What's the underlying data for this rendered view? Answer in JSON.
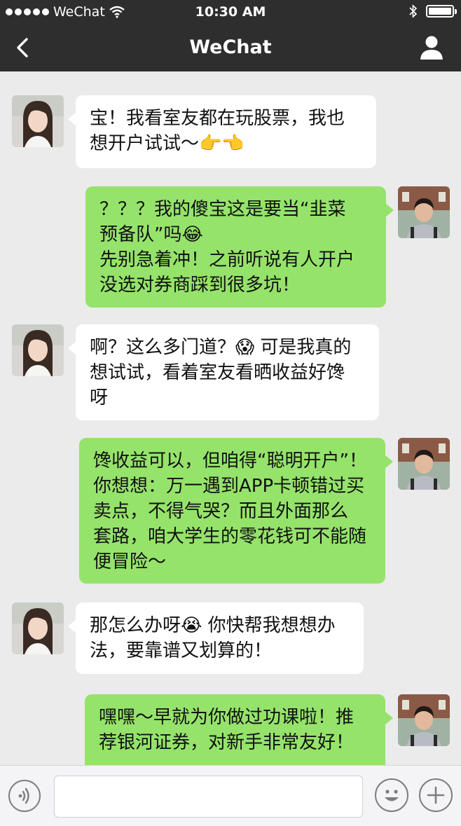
{
  "status_bar": {
    "carrier": "WeChat",
    "time": "10:30 AM"
  },
  "nav": {
    "title": "WeChat"
  },
  "messages": [
    {
      "from": "contact",
      "text": "宝！我看室友都在玩股票，我也\n想开户试试～👉👈"
    },
    {
      "from": "me",
      "text": "？？？我的傻宝这是要当“韭菜\n预备队”吗😂\n先别急着冲！之前听说有人开户\n没选对券商踩到很多坑！"
    },
    {
      "from": "contact",
      "text": "啊？这么多门道？😱 可是我真的\n想试试，看着室友看晒收益好馋\n呀"
    },
    {
      "from": "me",
      "text": "馋收益可以，但咱得“聪明开户”！\n你想想：万一遇到APP卡顿错过买\n卖点，不得气哭？而且外面那么\n套路，咱大学生的零花钱可不能随\n便冒险～"
    },
    {
      "from": "contact",
      "text": "那怎么办呀😭 你快帮我想想办\n法，要靠谱又划算的！"
    },
    {
      "from": "me",
      "text": "嘿嘿～早就为你做过功课啦！推\n荐银河证券，对新手非常友好！"
    }
  ],
  "input": {
    "placeholder": ""
  },
  "icons": {
    "back": "chevron-left-icon",
    "profile": "person-icon",
    "voice": "voice-icon",
    "emoji": "smiley-icon",
    "plus": "plus-icon"
  },
  "colors": {
    "nav_bg": "#2e2e2e",
    "chat_bg": "#ebebeb",
    "bubble_out": "#95e36b",
    "bubble_in": "#ffffff"
  }
}
